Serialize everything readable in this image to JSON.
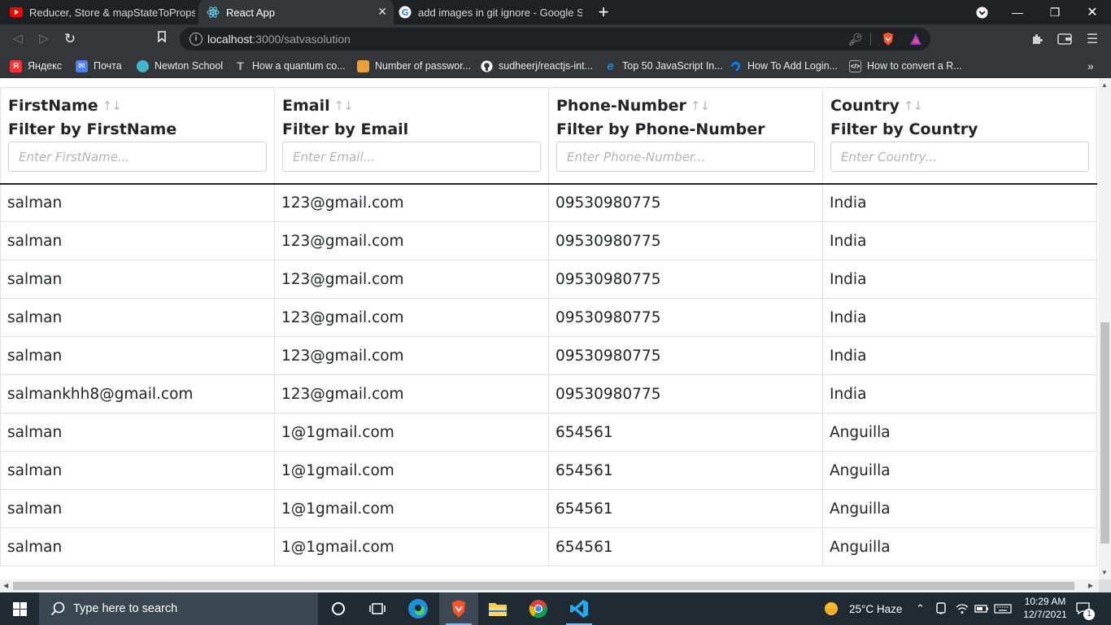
{
  "browser": {
    "tabs": [
      {
        "title": "Reducer, Store & mapStateToProps | R",
        "icon": "youtube-icon",
        "active": false
      },
      {
        "title": "React App",
        "icon": "react-icon",
        "active": true
      },
      {
        "title": "add images in git ignore - Google Sea",
        "icon": "google-icon",
        "active": false
      }
    ],
    "url_host": "localhost",
    "url_path": ":3000/satvasolution",
    "bookmarks": [
      {
        "label": "Яндекс",
        "icon": "yandex-icon",
        "color": "#ff3333",
        "glyph": "Я"
      },
      {
        "label": "Почта",
        "icon": "mail-icon",
        "color": "#4f7ef7",
        "glyph": "✉"
      },
      {
        "label": "Newton School",
        "icon": "newton-icon",
        "color": "#43b6c9",
        "glyph": "N"
      },
      {
        "label": "How a quantum co...",
        "icon": "t-icon",
        "color": "#9a9a9a",
        "glyph": "T"
      },
      {
        "label": "Number of passwor...",
        "icon": "puzzle-icon",
        "color": "#e9a23b",
        "glyph": "#"
      },
      {
        "label": "sudheerj/reactjs-int...",
        "icon": "github-icon",
        "color": "#ffffff",
        "glyph": "●"
      },
      {
        "label": "Top 50 JavaScript In...",
        "icon": "edureka-icon",
        "color": "#1e88e5",
        "glyph": "e"
      },
      {
        "label": "How To Add Login...",
        "icon": "digitalocean-icon",
        "color": "#0080ff",
        "glyph": "◗"
      },
      {
        "label": "How to convert a R...",
        "icon": "code-icon",
        "color": "#555555",
        "glyph": "</>"
      }
    ]
  },
  "table": {
    "columns": [
      {
        "name": "FirstName",
        "filter_label": "Filter by FirstName",
        "placeholder": "Enter FirstName..."
      },
      {
        "name": "Email",
        "filter_label": "Filter by Email",
        "placeholder": "Enter Email..."
      },
      {
        "name": "Phone-Number",
        "filter_label": "Filter by Phone-Number",
        "placeholder": "Enter Phone-Number..."
      },
      {
        "name": "Country",
        "filter_label": "Filter by Country",
        "placeholder": "Enter Country..."
      }
    ],
    "rows": [
      [
        "salman",
        "123@gmail.com",
        "09530980775",
        "India"
      ],
      [
        "salman",
        "123@gmail.com",
        "09530980775",
        "India"
      ],
      [
        "salman",
        "123@gmail.com",
        "09530980775",
        "India"
      ],
      [
        "salman",
        "123@gmail.com",
        "09530980775",
        "India"
      ],
      [
        "salman",
        "123@gmail.com",
        "09530980775",
        "India"
      ],
      [
        "salmankhh8@gmail.com",
        "123@gmail.com",
        "09530980775",
        "India"
      ],
      [
        "salman",
        "1@1gmail.com",
        "654561",
        "Anguilla"
      ],
      [
        "salman",
        "1@1gmail.com",
        "654561",
        "Anguilla"
      ],
      [
        "salman",
        "1@1gmail.com",
        "654561",
        "Anguilla"
      ],
      [
        "salman",
        "1@1gmail.com",
        "654561",
        "Anguilla"
      ]
    ]
  },
  "taskbar": {
    "search_placeholder": "Type here to search",
    "weather": "25°C  Haze",
    "time": "10:29 AM",
    "date": "12/7/2021",
    "notifications": "1"
  }
}
